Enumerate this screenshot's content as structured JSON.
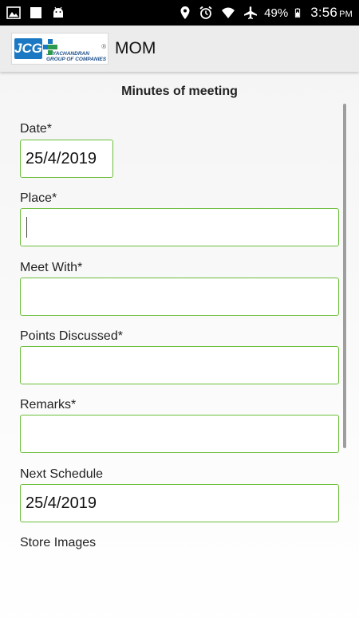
{
  "status_bar": {
    "battery": "49%",
    "time": "3:56",
    "ampm": "PM",
    "left_icons": [
      "image-icon",
      "square-icon",
      "android-icon"
    ],
    "right_icons": [
      "location-icon",
      "alarm-icon",
      "wifi-icon",
      "airplane-icon",
      "battery-icon"
    ]
  },
  "app_bar": {
    "title": "MOM",
    "logo": {
      "mark": "JCG",
      "line1": "JAYACHANDRAN",
      "line2": "GROUP OF COMPANIES",
      "reg": "®"
    }
  },
  "form": {
    "heading": "Minutes of meeting",
    "date": {
      "label": "Date*",
      "value": "25/4/2019"
    },
    "place": {
      "label": "Place*",
      "value": ""
    },
    "meet_with": {
      "label": "Meet With*",
      "value": ""
    },
    "points_discussed": {
      "label": "Points Discussed*",
      "value": ""
    },
    "remarks": {
      "label": "Remarks*",
      "value": ""
    },
    "next_schedule": {
      "label": "Next Schedule",
      "value": "25/4/2019"
    },
    "store_images": {
      "label": "Store Images"
    }
  },
  "colors": {
    "field_border": "#6cbf3a",
    "status_bar": "#000000",
    "app_bar": "#ececec",
    "logo_blue": "#1b78c2"
  }
}
